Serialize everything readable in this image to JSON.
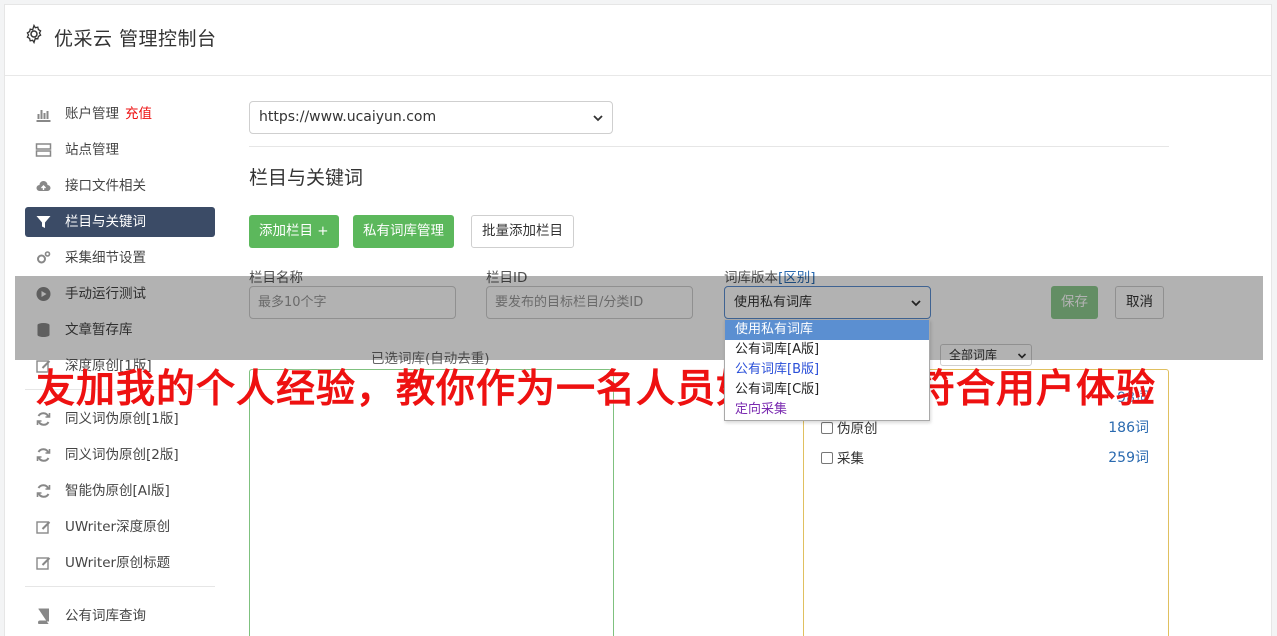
{
  "header": {
    "title": "优采云 管理控制台",
    "icon": "gear-icon"
  },
  "sidebar": {
    "items": [
      {
        "label": "账户管理",
        "badge": "充值",
        "icon": "bar-chart-icon"
      },
      {
        "label": "站点管理",
        "icon": "server-icon"
      },
      {
        "label": "接口文件相关",
        "icon": "cloud-upload-icon"
      },
      {
        "label": "栏目与关键词",
        "icon": "filter-icon",
        "active": true
      },
      {
        "label": "采集细节设置",
        "icon": "cogs-icon"
      },
      {
        "label": "手动运行测试",
        "icon": "play-icon"
      },
      {
        "label": "文章暂存库",
        "icon": "database-icon"
      },
      {
        "label": "深度原创[1版]",
        "icon": "edit-icon"
      },
      {
        "label": "同义词伪原创[1版]",
        "icon": "refresh-icon"
      },
      {
        "label": "同义词伪原创[2版]",
        "icon": "refresh-icon"
      },
      {
        "label": "智能伪原创[AI版]",
        "icon": "refresh-icon"
      },
      {
        "label": "UWriter深度原创",
        "icon": "edit-icon"
      },
      {
        "label": "UWriter原创标题",
        "icon": "edit-icon"
      },
      {
        "label": "公有词库查询",
        "icon": "book-icon"
      }
    ]
  },
  "main": {
    "site_select": {
      "value": "https://www.ucaiyun.com"
    },
    "section_title": "栏目与关键词",
    "buttons": {
      "add_column": "添加栏目 +",
      "private_lib": "私有词库管理",
      "batch_add": "批量添加栏目"
    },
    "form": {
      "name_label": "栏目名称",
      "name_placeholder": "最多10个字",
      "id_label": "栏目ID",
      "id_placeholder": "要发布的目标栏目/分类ID",
      "version_label": "词库版本",
      "version_link": "[区别]",
      "version_value": "使用私有词库",
      "version_options": [
        "使用私有词库",
        "公有词库[A版]",
        "公有词库[B版]",
        "公有词库[C版]",
        "定向采集"
      ],
      "save": "保存",
      "cancel": "取消"
    },
    "selected_lib_label": "已选词库(自动去重)",
    "lib_filter": "全部词库",
    "lib_items": [
      {
        "label": "伪原创",
        "count": "186词"
      },
      {
        "label": "采集",
        "count": "259词"
      }
    ],
    "lib_partial_count": "98词"
  },
  "banner": "友加我的个人经验，教你作为一名人员如何撰写出符合用户体验"
}
